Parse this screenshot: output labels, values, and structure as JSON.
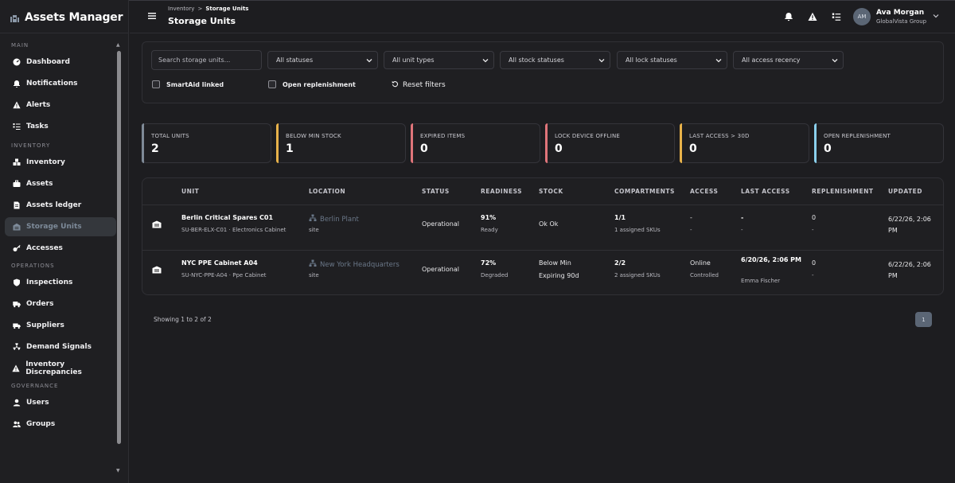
{
  "app": {
    "title": "Assets Manager"
  },
  "sidebar": {
    "sections": [
      {
        "label": "MAIN",
        "items": [
          {
            "label": "Dashboard",
            "icon": "dashboard-icon"
          },
          {
            "label": "Notifications",
            "icon": "bell-icon"
          },
          {
            "label": "Alerts",
            "icon": "warning-icon"
          },
          {
            "label": "Tasks",
            "icon": "tasks-icon"
          }
        ]
      },
      {
        "label": "INVENTORY",
        "items": [
          {
            "label": "Inventory",
            "icon": "boxes-icon"
          },
          {
            "label": "Assets",
            "icon": "briefcase-icon"
          },
          {
            "label": "Assets ledger",
            "icon": "document-icon"
          },
          {
            "label": "Storage Units",
            "icon": "warehouse-icon",
            "active": true
          },
          {
            "label": "Accesses",
            "icon": "key-icon"
          }
        ]
      },
      {
        "label": "OPERATIONS",
        "items": [
          {
            "label": "Inspections",
            "icon": "shield-icon"
          },
          {
            "label": "Orders",
            "icon": "truck-icon"
          },
          {
            "label": "Suppliers",
            "icon": "delivery-icon"
          },
          {
            "label": "Demand Signals",
            "icon": "radiation-icon"
          },
          {
            "label": "Inventory Discrepancies",
            "icon": "warning-icon"
          }
        ]
      },
      {
        "label": "GOVERNANCE",
        "items": [
          {
            "label": "Users",
            "icon": "user-icon"
          },
          {
            "label": "Groups",
            "icon": "users-icon"
          }
        ]
      }
    ]
  },
  "header": {
    "breadcrumb": [
      "Inventory",
      "Storage Units"
    ],
    "title": "Storage Units",
    "user": {
      "initials": "AM",
      "name": "Ava Morgan",
      "org": "GlobalVista Group"
    }
  },
  "filters": {
    "search_placeholder": "Search storage units...",
    "selects": [
      "All statuses",
      "All unit types",
      "All stock statuses",
      "All lock statuses",
      "All access recency"
    ],
    "checkboxes": [
      {
        "label": "SmartAid linked",
        "checked": false
      },
      {
        "label": "Open replenishment",
        "checked": false
      }
    ],
    "reset_label": "Reset filters"
  },
  "stats": [
    {
      "label": "TOTAL UNITS",
      "value": "2",
      "color": "#7f8a97"
    },
    {
      "label": "BELOW MIN STOCK",
      "value": "1",
      "color": "#e8b24a"
    },
    {
      "label": "EXPIRED ITEMS",
      "value": "0",
      "color": "#e0757a"
    },
    {
      "label": "LOCK DEVICE OFFLINE",
      "value": "0",
      "color": "#e0757a"
    },
    {
      "label": "LAST ACCESS > 30D",
      "value": "0",
      "color": "#e8b24a"
    },
    {
      "label": "OPEN REPLENISHMENT",
      "value": "0",
      "color": "#8ad0ec"
    }
  ],
  "table": {
    "columns": [
      "UNIT",
      "LOCATION",
      "STATUS",
      "READINESS",
      "STOCK",
      "COMPARTMENTS",
      "ACCESS",
      "LAST ACCESS",
      "REPLENISHMENT",
      "UPDATED"
    ],
    "rows": [
      {
        "unit": "Berlin Critical Spares C01",
        "unit_sub": "SU-BER-ELX-C01 · Electronics Cabinet",
        "location": "Berlin Plant",
        "location_sub": "site",
        "status": "Operational",
        "readiness": "91%",
        "readiness_sub": "Ready",
        "stock": "Ok Ok",
        "stock_sub": "",
        "compartments": "1/1",
        "compartments_sub": "1 assigned SKUs",
        "access": "-",
        "access_sub": "-",
        "last_access": "-",
        "last_access_sub": "-",
        "last_access_by": "",
        "replenishment": "0",
        "replenishment_sub": "-",
        "updated": "6/22/26, 2:06 PM"
      },
      {
        "unit": "NYC PPE Cabinet A04",
        "unit_sub": "SU-NYC-PPE-A04 · Ppe Cabinet",
        "location": "New York Headquarters",
        "location_sub": "site",
        "status": "Operational",
        "readiness": "72%",
        "readiness_sub": "Degraded",
        "stock": "Below Min",
        "stock_sub": "Expiring 90d",
        "compartments": "2/2",
        "compartments_sub": "2 assigned SKUs",
        "access": "Online",
        "access_sub": "Controlled",
        "last_access": "6/20/26, 2:06 PM",
        "last_access_sub": "",
        "last_access_by": "Emma Fischer",
        "replenishment": "0",
        "replenishment_sub": "-",
        "updated": "6/22/26, 2:06 PM"
      }
    ]
  },
  "pagination": {
    "summary": "Showing 1 to 2 of 2",
    "current_page": "1"
  }
}
